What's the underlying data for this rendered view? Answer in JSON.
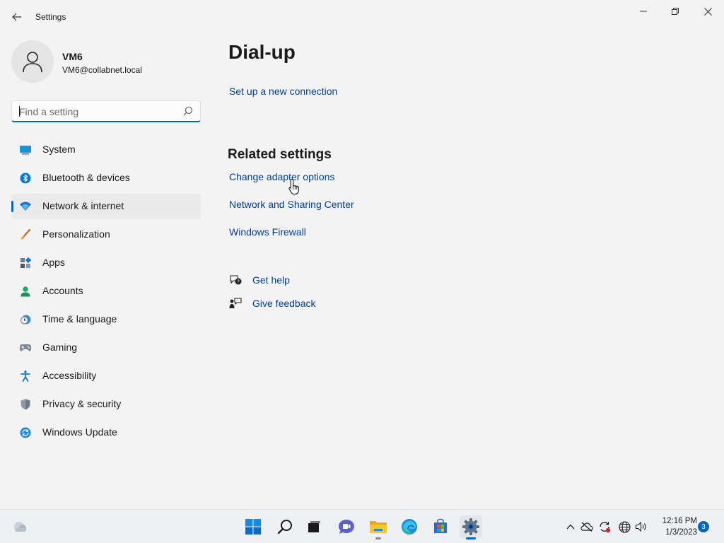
{
  "window": {
    "title": "Settings",
    "back_icon": "back-arrow-icon",
    "controls": [
      "minimize-icon",
      "restore-icon",
      "close-icon"
    ]
  },
  "profile": {
    "name": "VM6",
    "email": "VM6@collabnet.local",
    "avatar_icon": "user-icon"
  },
  "search": {
    "placeholder": "Find a setting",
    "value": "",
    "icon": "search-icon"
  },
  "sidebar": {
    "items": [
      {
        "label": "System",
        "icon": "system-display-icon",
        "active": false
      },
      {
        "label": "Bluetooth & devices",
        "icon": "bluetooth-icon",
        "active": false
      },
      {
        "label": "Network & internet",
        "icon": "wifi-icon",
        "active": true
      },
      {
        "label": "Personalization",
        "icon": "brush-icon",
        "active": false
      },
      {
        "label": "Apps",
        "icon": "apps-icon",
        "active": false
      },
      {
        "label": "Accounts",
        "icon": "accounts-icon",
        "active": false
      },
      {
        "label": "Time & language",
        "icon": "clock-globe-icon",
        "active": false
      },
      {
        "label": "Gaming",
        "icon": "gamepad-icon",
        "active": false
      },
      {
        "label": "Accessibility",
        "icon": "accessibility-icon",
        "active": false
      },
      {
        "label": "Privacy & security",
        "icon": "shield-icon",
        "active": false
      },
      {
        "label": "Windows Update",
        "icon": "update-icon",
        "active": false
      }
    ]
  },
  "main": {
    "title": "Dial-up",
    "setup_link": "Set up a new connection",
    "related_title": "Related settings",
    "related_links": [
      "Change adapter options",
      "Network and Sharing Center",
      "Windows Firewall"
    ],
    "help": [
      {
        "label": "Get help",
        "icon": "help-chat-icon"
      },
      {
        "label": "Give feedback",
        "icon": "feedback-icon"
      }
    ]
  },
  "taskbar": {
    "apps": [
      "start-icon",
      "search-icon",
      "task-view-icon",
      "chat-icon",
      "file-explorer-icon",
      "edge-icon",
      "store-icon",
      "settings-icon"
    ],
    "active_app": "settings-icon",
    "tray": [
      "chevron-up-icon",
      "network-off-icon",
      "sync-icon",
      "globe-icon",
      "volume-icon"
    ],
    "time": "12:16 PM",
    "date": "1/3/2023",
    "notification_count": "3"
  },
  "colors": {
    "accent": "#0067c0",
    "link": "#003e92",
    "background": "#f3f3f3"
  }
}
